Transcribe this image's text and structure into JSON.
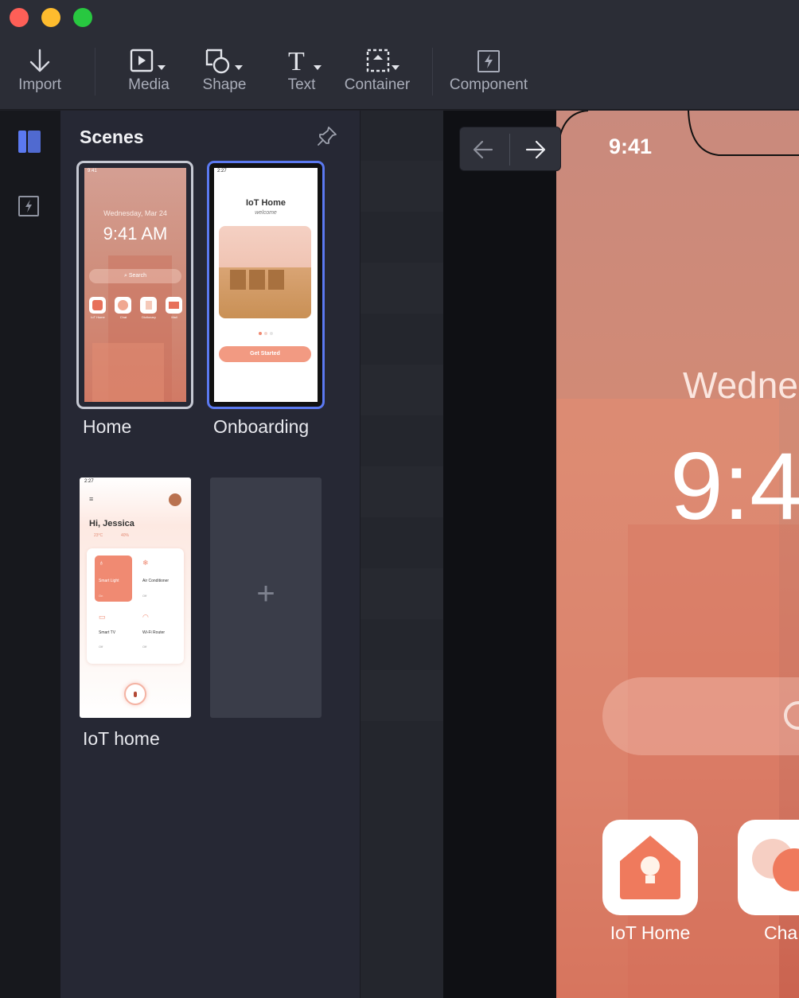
{
  "window": {
    "controls": [
      "close",
      "minimize",
      "maximize"
    ]
  },
  "toolbar": {
    "import_label": "Import",
    "media_label": "Media",
    "shape_label": "Shape",
    "text_label": "Text",
    "container_label": "Container",
    "component_label": "Component"
  },
  "rail": {
    "items": [
      "scenes-panel-icon",
      "component-icon"
    ]
  },
  "scenes": {
    "title": "Scenes",
    "items": [
      {
        "label": "Home",
        "state": "default",
        "preview": {
          "time_status": "9:41",
          "date": "Wednesday, Mar 24",
          "time": "9:41 AM",
          "search": "Search",
          "apps": [
            "IoT Home",
            "Chat",
            "Dictionary",
            "Mail"
          ]
        }
      },
      {
        "label": "Onboarding",
        "state": "selected",
        "preview": {
          "time_status": "2:27",
          "title": "IoT Home",
          "subtitle": "welcome",
          "cta": "Get Started"
        }
      },
      {
        "label": "IoT home",
        "state": "default",
        "preview": {
          "time_status": "2:27",
          "greeting": "Hi, Jessica",
          "temp": "23°C",
          "humidity": "40%",
          "devices": [
            {
              "name": "Smart Light",
              "status": "On"
            },
            {
              "name": "Air Conditioner",
              "status": "Off"
            },
            {
              "name": "Smart TV",
              "status": "Off"
            },
            {
              "name": "Wi-Fi Router",
              "status": "Off"
            }
          ]
        }
      }
    ],
    "add_label": "+"
  },
  "canvas": {
    "status_time": "9:41",
    "date_partial": "Wedne",
    "time_partial": "9:4",
    "apps": [
      {
        "label": "IoT Home"
      },
      {
        "label": "Cha"
      }
    ]
  },
  "colors": {
    "accent": "#5b79f0",
    "toolbar_bg": "#2b2d36",
    "panel_bg": "#262834",
    "phone_coral": "#d38a74"
  }
}
